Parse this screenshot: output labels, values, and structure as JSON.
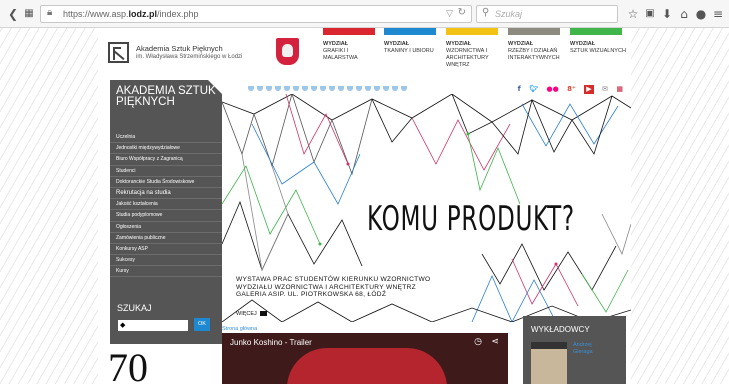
{
  "browser": {
    "url_prefix": "https://www.asp.",
    "url_domain": "lodz.pl",
    "url_path": "/index.php",
    "search_placeholder": "Szukaj"
  },
  "header": {
    "institution_name": "Akademia Sztuk Pięknych",
    "institution_sub": "im. Władysława Strzemińskiego w Łodzi",
    "faculties": [
      {
        "line1": "WYDZIAŁ",
        "line2": "GRAFIKI I MALARSTWA",
        "color": "#d9262f"
      },
      {
        "line1": "WYDZIAŁ",
        "line2": "TKANINY I UBIORU",
        "color": "#1e88d0"
      },
      {
        "line1": "WYDZIAŁ",
        "line2": "WZORNICTWA I ARCHITEKTURY WNĘTRZ",
        "color": "#f2c314"
      },
      {
        "line1": "WYDZIAŁ",
        "line2": "RZEŹBY I DZIAŁAŃ INTERAKTYWNYCH",
        "color": "#8d8a7f"
      },
      {
        "line1": "WYDZIAŁ",
        "line2": "SZTUK WIZUALNYCH",
        "color": "#3fb54a"
      }
    ]
  },
  "sidebar": {
    "title": "AKADEMIA SZTUK PIĘKNYCH",
    "items": [
      "Uczelnia",
      "Jednostki międzywydziałowe",
      "Biuro Współpracy z Zagranicą",
      "Studenci",
      "Doktoranckie Studia Środowiskowe",
      "Rekrutacja na studia",
      "Jakość kształcenia",
      "Studia podyplomowe",
      "Ogłoszenia",
      "Zamówienia publiczne",
      "Konkursy ASP",
      "Sukcesy",
      "Kursy"
    ]
  },
  "search": {
    "title": "SZUKAJ",
    "button": "OK"
  },
  "decor_number": "70",
  "banner": {
    "headline": "KOMU PRODUKT?",
    "desc_line1": "WYSTAWA PRAC STUDENTÓW KIERUNKU WZORNICTWO",
    "desc_line2": "WYDZIAŁU WZORNICTWA I ARCHITEKTURY WNĘTRZ",
    "desc_line3": "GALERIA ASIP. UL. PIOTRKOWSKA 68, ŁÓDŹ",
    "more": "WIĘCEJ"
  },
  "breadcrumb": "Strona główna",
  "video": {
    "title": "Junko Koshino - Trailer"
  },
  "lecturers": {
    "title": "WYKŁADOWCY",
    "name_line1": "Andrzej",
    "name_line2": "Gieraga"
  },
  "colors": {
    "panel": "#555555",
    "accent_blue": "#1e88d0",
    "link_blue": "#3a8fd6"
  }
}
